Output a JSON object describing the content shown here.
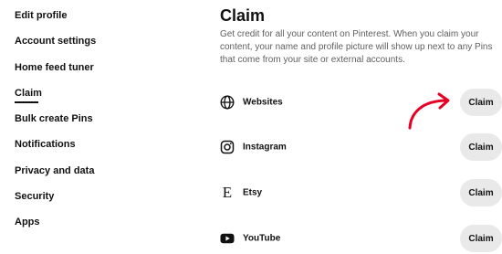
{
  "sidebar": {
    "items": [
      {
        "label": "Edit profile"
      },
      {
        "label": "Account settings"
      },
      {
        "label": "Home feed tuner"
      },
      {
        "label": "Claim",
        "active": true
      },
      {
        "label": "Bulk create Pins"
      },
      {
        "label": "Notifications"
      },
      {
        "label": "Privacy and data"
      },
      {
        "label": "Security"
      },
      {
        "label": "Apps"
      }
    ]
  },
  "main": {
    "title": "Claim",
    "description": "Get credit for all your content on Pinterest. When you claim your content, your name and profile picture will show up next to any Pins that come from your site or external accounts.",
    "accounts": [
      {
        "label": "Websites",
        "icon": "globe-icon",
        "button": "Claim"
      },
      {
        "label": "Instagram",
        "icon": "instagram-icon",
        "button": "Claim"
      },
      {
        "label": "Etsy",
        "icon": "etsy-icon",
        "icon_glyph": "E",
        "button": "Claim"
      },
      {
        "label": "YouTube",
        "icon": "youtube-icon",
        "button": "Claim"
      }
    ]
  },
  "annotation": {
    "arrow_color": "#e60023"
  },
  "colors": {
    "button_bg": "#e9e9e9",
    "text": "#111111",
    "muted": "#5f5f5f"
  }
}
